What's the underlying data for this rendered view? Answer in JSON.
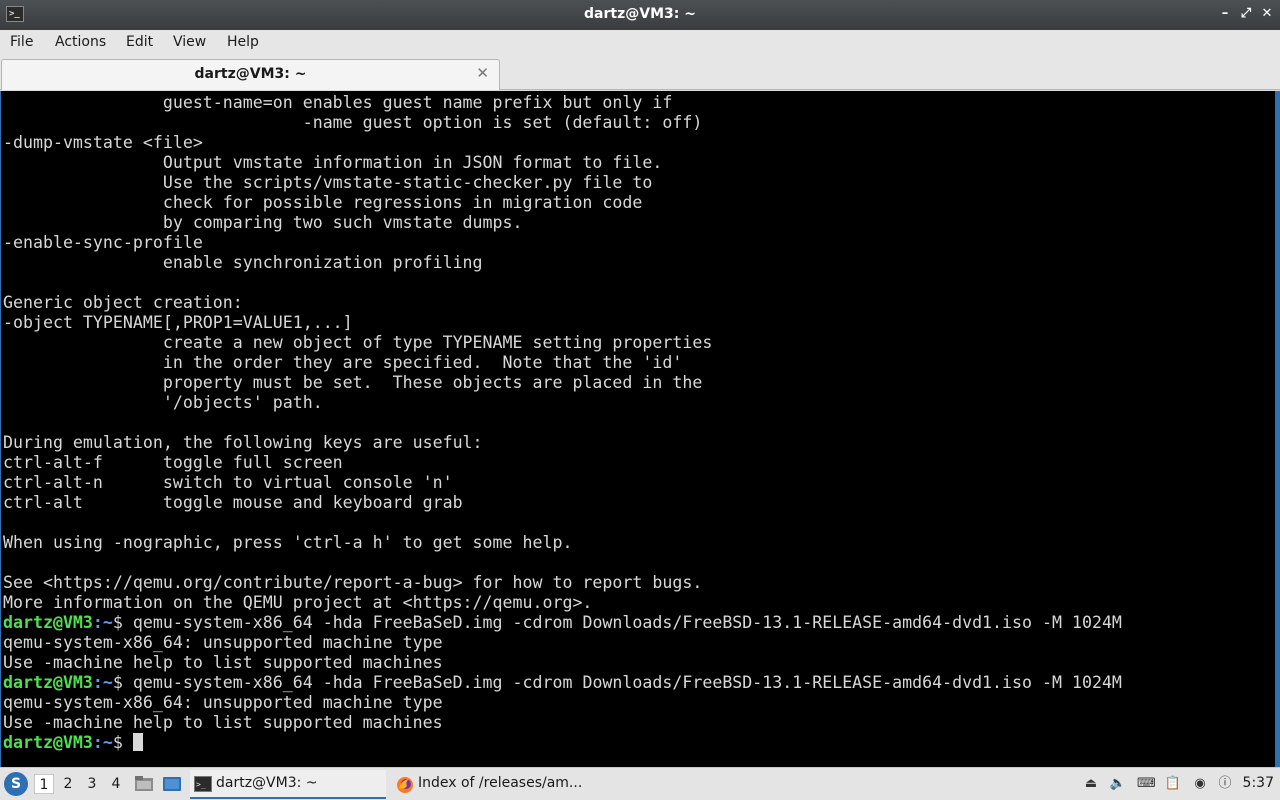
{
  "window": {
    "title": "dartz@VM3: ~",
    "app_icon": "terminal-icon",
    "buttons": {
      "minimize": "–",
      "restore": "⤢",
      "close": "✕"
    }
  },
  "menu": [
    "File",
    "Actions",
    "Edit",
    "View",
    "Help"
  ],
  "tab": {
    "label": "dartz@VM3: ~",
    "close": "✕"
  },
  "terminal": {
    "lines": [
      {
        "t": "                guest-name=on enables guest name prefix but only if"
      },
      {
        "t": "                              -name guest option is set (default: off)"
      },
      {
        "t": "-dump-vmstate <file>"
      },
      {
        "t": "                Output vmstate information in JSON format to file."
      },
      {
        "t": "                Use the scripts/vmstate-static-checker.py file to"
      },
      {
        "t": "                check for possible regressions in migration code"
      },
      {
        "t": "                by comparing two such vmstate dumps."
      },
      {
        "t": "-enable-sync-profile"
      },
      {
        "t": "                enable synchronization profiling"
      },
      {
        "t": ""
      },
      {
        "t": "Generic object creation:"
      },
      {
        "t": "-object TYPENAME[,PROP1=VALUE1,...]"
      },
      {
        "t": "                create a new object of type TYPENAME setting properties"
      },
      {
        "t": "                in the order they are specified.  Note that the 'id'"
      },
      {
        "t": "                property must be set.  These objects are placed in the"
      },
      {
        "t": "                '/objects' path."
      },
      {
        "t": ""
      },
      {
        "t": "During emulation, the following keys are useful:"
      },
      {
        "t": "ctrl-alt-f      toggle full screen"
      },
      {
        "t": "ctrl-alt-n      switch to virtual console 'n'"
      },
      {
        "t": "ctrl-alt        toggle mouse and keyboard grab"
      },
      {
        "t": ""
      },
      {
        "t": "When using -nographic, press 'ctrl-a h' to get some help."
      },
      {
        "t": ""
      },
      {
        "t": "See <https://qemu.org/contribute/report-a-bug> for how to report bugs."
      },
      {
        "t": "More information on the QEMU project at <https://qemu.org>."
      },
      {
        "user": "dartz@VM3",
        "path": ":~",
        "t": "$ qemu-system-x86_64 -hda FreeBaSeD.img -cdrom Downloads/FreeBSD-13.1-RELEASE-amd64-dvd1.iso -M 1024M"
      },
      {
        "t": "qemu-system-x86_64: unsupported machine type"
      },
      {
        "t": "Use -machine help to list supported machines"
      },
      {
        "user": "dartz@VM3",
        "path": ":~",
        "t": "$ qemu-system-x86_64 -hda FreeBaSeD.img -cdrom Downloads/FreeBSD-13.1-RELEASE-amd64-dvd1.iso -M 1024M"
      },
      {
        "t": "qemu-system-x86_64: unsupported machine type"
      },
      {
        "t": "Use -machine help to list supported machines"
      },
      {
        "user": "dartz@VM3",
        "path": ":~",
        "t": "$ ",
        "cursor": true
      }
    ]
  },
  "taskbar": {
    "start_icon": "lxqt-start-icon",
    "desktops": [
      "1",
      "2",
      "3",
      "4"
    ],
    "active_desktop": "1",
    "quicklaunch": [
      "file-manager-icon",
      "show-desktop-icon"
    ],
    "tasks": [
      {
        "label": "dartz@VM3: ~",
        "icon": "terminal-icon",
        "active": true
      },
      {
        "label": "Index of /releases/am...",
        "icon": "firefox-icon",
        "active": false
      }
    ],
    "tray": [
      "eject-icon",
      "volume-icon",
      "keyboard-icon",
      "clipboard-icon",
      "network-icon",
      "update-notifier-icon"
    ],
    "clock": "5:37"
  },
  "colors": {
    "terminal_bg": "#000000",
    "terminal_fg": "#d8d8d8",
    "prompt_user": "#4ee04e",
    "prompt_path": "#5c9cff",
    "accent": "#2f6fb4"
  }
}
